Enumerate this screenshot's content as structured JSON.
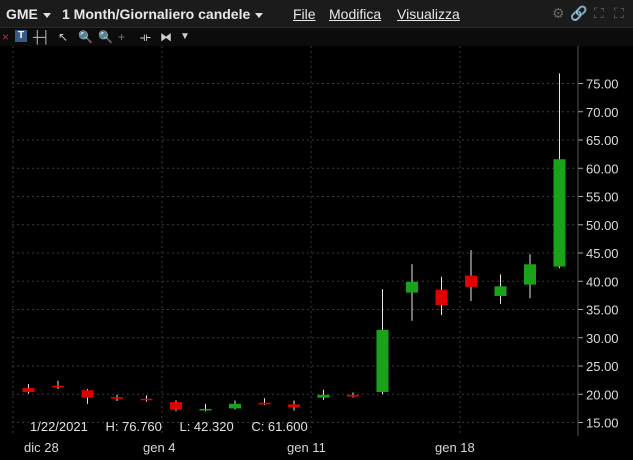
{
  "header": {
    "symbol": "GME",
    "period": "1 Month/Giornaliero candele",
    "menu": [
      "File",
      "Modifica",
      "Visualizza"
    ]
  },
  "toolbar": {
    "text_tool_label": "T",
    "icons": [
      "text-icon",
      "bar-icon",
      "candle-icon",
      "cursor-icon",
      "zoom-in-icon",
      "zoom-out-icon",
      "crosshair-icon",
      "expand-icon",
      "fit-icon",
      "dropdown-icon"
    ]
  },
  "readout": {
    "date": "1/22/2021",
    "high": "H: 76.760",
    "low": "L: 42.320",
    "close": "C: 61.600"
  },
  "xaxis_labels": [
    "dic 28",
    "gen 4",
    "gen 11",
    "gen 18"
  ],
  "colors": {
    "up": "#1aa31a",
    "down": "#e00000",
    "background": "#000000",
    "grid": "#3a3a3a"
  },
  "chart_data": {
    "type": "candlestick",
    "ylim": [
      12,
      78
    ],
    "yticks": [
      "15.00",
      "20.00",
      "25.00",
      "30.00",
      "35.00",
      "40.00",
      "45.00",
      "50.00",
      "55.00",
      "60.00",
      "65.00",
      "70.00",
      "75.00"
    ],
    "candles": [
      {
        "o": 21.1,
        "h": 21.8,
        "l": 20.1,
        "c": 20.4
      },
      {
        "o": 21.5,
        "h": 22.4,
        "l": 20.9,
        "c": 21.3
      },
      {
        "o": 20.7,
        "h": 20.9,
        "l": 18.3,
        "c": 19.4
      },
      {
        "o": 19.5,
        "h": 19.9,
        "l": 18.8,
        "c": 19.2
      },
      {
        "o": 19.2,
        "h": 19.8,
        "l": 18.7,
        "c": 19.0
      },
      {
        "o": 18.6,
        "h": 18.9,
        "l": 17.0,
        "c": 17.3
      },
      {
        "o": 17.2,
        "h": 18.3,
        "l": 17.0,
        "c": 17.4
      },
      {
        "o": 17.5,
        "h": 18.9,
        "l": 17.3,
        "c": 18.3
      },
      {
        "o": 18.5,
        "h": 19.3,
        "l": 18.1,
        "c": 18.2
      },
      {
        "o": 18.2,
        "h": 18.9,
        "l": 17.1,
        "c": 17.7
      },
      {
        "o": 19.4,
        "h": 20.8,
        "l": 19.0,
        "c": 19.9
      },
      {
        "o": 19.9,
        "h": 20.3,
        "l": 19.4,
        "c": 19.6
      },
      {
        "o": 20.4,
        "h": 38.6,
        "l": 20.0,
        "c": 31.4
      },
      {
        "o": 38.0,
        "h": 43.0,
        "l": 33.0,
        "c": 39.9
      },
      {
        "o": 38.5,
        "h": 40.8,
        "l": 34.0,
        "c": 35.8
      },
      {
        "o": 41.0,
        "h": 45.5,
        "l": 36.5,
        "c": 39.0
      },
      {
        "o": 37.4,
        "h": 41.2,
        "l": 36.0,
        "c": 39.1
      },
      {
        "o": 39.4,
        "h": 44.8,
        "l": 37.0,
        "c": 43.0
      },
      {
        "o": 42.6,
        "h": 76.8,
        "l": 42.3,
        "c": 61.6
      }
    ]
  }
}
